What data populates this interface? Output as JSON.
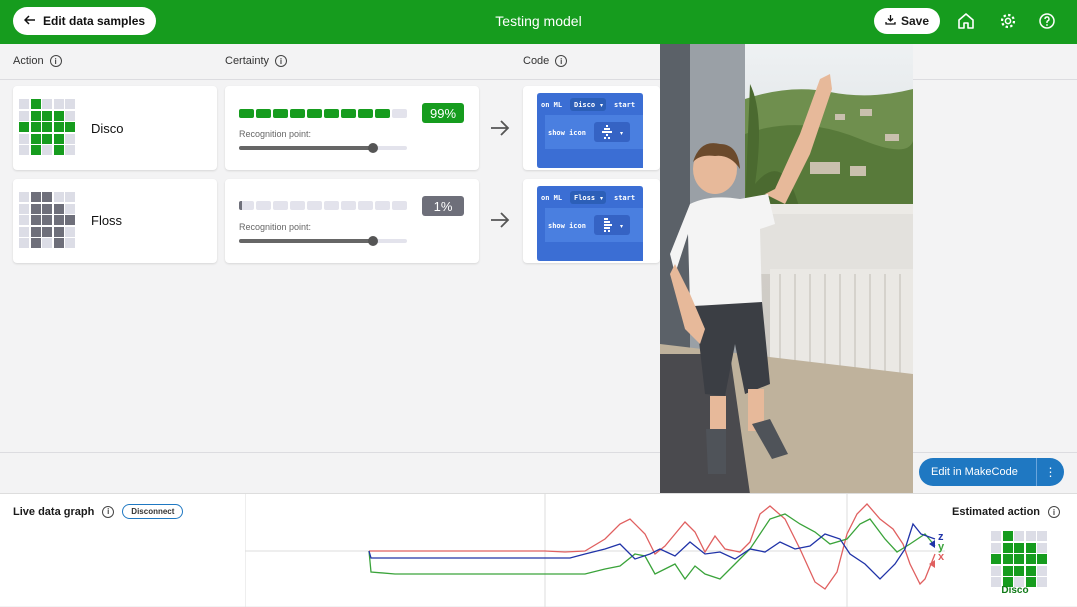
{
  "header": {
    "back_label": "Edit data samples",
    "title": "Testing model",
    "save_label": "Save"
  },
  "columns": {
    "action": "Action",
    "certainty": "Certainty",
    "code": "Code"
  },
  "colors": {
    "primary": "#169c1e",
    "blue": "#1f78c2",
    "makecode_block": "#3b6ed4",
    "inactive": "#6e6f7a"
  },
  "actions": [
    {
      "name": "Disco",
      "certainty_label": "99%",
      "certainty_pct": 99,
      "recognition_label": "Recognition point:",
      "recognition_point": 0.8,
      "icon_pattern": [
        0,
        1,
        0,
        0,
        0,
        0,
        1,
        1,
        1,
        0,
        1,
        1,
        1,
        1,
        1,
        0,
        1,
        1,
        1,
        0,
        0,
        1,
        0,
        1,
        0
      ],
      "code": {
        "on_ml": "on ML",
        "name": "Disco",
        "start": "start",
        "show_icon": "show icon"
      }
    },
    {
      "name": "Floss",
      "certainty_label": "1%",
      "certainty_pct": 1,
      "recognition_label": "Recognition point:",
      "recognition_point": 0.8,
      "icon_pattern": [
        0,
        1,
        1,
        0,
        0,
        0,
        1,
        1,
        1,
        0,
        0,
        1,
        1,
        1,
        1,
        0,
        1,
        1,
        1,
        0,
        0,
        1,
        0,
        1,
        0
      ],
      "code": {
        "on_ml": "on ML",
        "name": "Floss",
        "start": "start",
        "show_icon": "show icon"
      }
    }
  ],
  "makecode": {
    "label": "Edit in MakeCode",
    "more": "⋮"
  },
  "live_graph": {
    "title": "Live data graph",
    "disconnect_label": "Disconnect",
    "legend": [
      "z",
      "y",
      "x"
    ]
  },
  "estimated": {
    "title": "Estimated action",
    "action": "Disco"
  },
  "icons": [
    "arrow-left-icon",
    "download-icon",
    "home-icon",
    "gear-icon",
    "help-icon",
    "info-icon",
    "arrow-right-icon"
  ]
}
